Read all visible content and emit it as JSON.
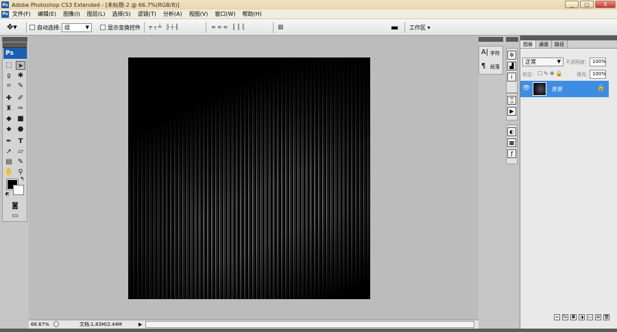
{
  "window": {
    "title": "Adobe Photoshop CS3 Extended - [未标题-2 @ 66.7%(RGB/8)]",
    "minimize": "_",
    "maximize": "□",
    "close": "X"
  },
  "menu": [
    "文件(F)",
    "编辑(E)",
    "图像(I)",
    "图层(L)",
    "选择(S)",
    "滤镜(T)",
    "分析(A)",
    "视图(V)",
    "窗口(W)",
    "帮助(H)"
  ],
  "options": {
    "auto_select_label": "自动选择:",
    "auto_select_value": "组",
    "show_transform_label": "显示变换控件",
    "workspace_label": "工作区 ▾"
  },
  "tools": {
    "logo": "Ps"
  },
  "character_panel": {
    "character": "字符",
    "paragraph": "段落"
  },
  "layers_panel": {
    "tabs": [
      "图层",
      "通道",
      "路径"
    ],
    "blend_mode": "正常",
    "opacity_label": "不透明度:",
    "opacity_value": "100%",
    "lock_label": "锁定:",
    "fill_label": "填充:",
    "fill_value": "100%",
    "layer_name": "背景"
  },
  "status": {
    "zoom": "66.67%",
    "doc_info": "文档:1.83M/2.44M"
  },
  "colors": {
    "accent": "#3d8ee3",
    "ps_blue": "#1c5fb0"
  }
}
